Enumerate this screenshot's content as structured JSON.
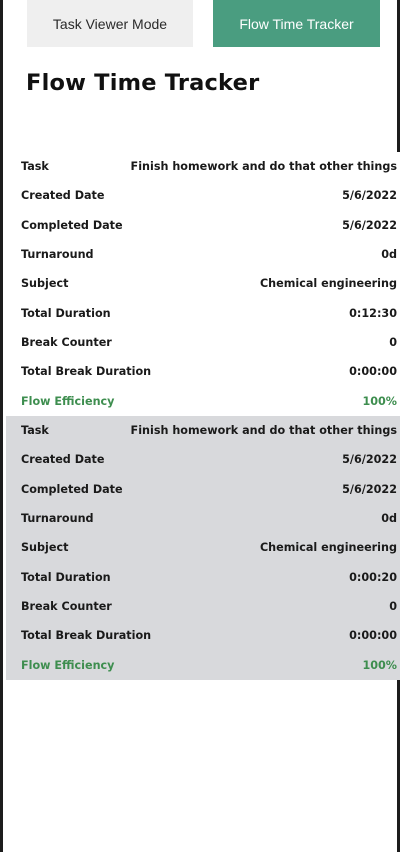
{
  "tabs": {
    "task_viewer": "Task Viewer Mode",
    "flow_tracker": "Flow Time Tracker"
  },
  "page_title": "Flow Time Tracker",
  "accent_color": "#4a9d80",
  "efficiency_color": "#3e8e4f",
  "records": [
    {
      "task": {
        "label": "Task",
        "value": "Finish homework and do that other things"
      },
      "created": {
        "label": "Created Date",
        "value": "5/6/2022"
      },
      "completed": {
        "label": "Completed Date",
        "value": "5/6/2022"
      },
      "turnaround": {
        "label": "Turnaround",
        "value": "0d"
      },
      "subject": {
        "label": "Subject",
        "value": "Chemical engineering"
      },
      "total_duration": {
        "label": "Total Duration",
        "value": "0:12:30"
      },
      "break_counter": {
        "label": "Break Counter",
        "value": "0"
      },
      "total_break_duration": {
        "label": "Total Break Duration",
        "value": "0:00:00"
      },
      "flow_efficiency": {
        "label": "Flow Efficiency",
        "value": "100%"
      }
    },
    {
      "task": {
        "label": "Task",
        "value": "Finish homework and do that other things"
      },
      "created": {
        "label": "Created Date",
        "value": "5/6/2022"
      },
      "completed": {
        "label": "Completed Date",
        "value": "5/6/2022"
      },
      "turnaround": {
        "label": "Turnaround",
        "value": "0d"
      },
      "subject": {
        "label": "Subject",
        "value": "Chemical engineering"
      },
      "total_duration": {
        "label": "Total Duration",
        "value": "0:00:20"
      },
      "break_counter": {
        "label": "Break Counter",
        "value": "0"
      },
      "total_break_duration": {
        "label": "Total Break Duration",
        "value": "0:00:00"
      },
      "flow_efficiency": {
        "label": "Flow Efficiency",
        "value": "100%"
      }
    }
  ]
}
